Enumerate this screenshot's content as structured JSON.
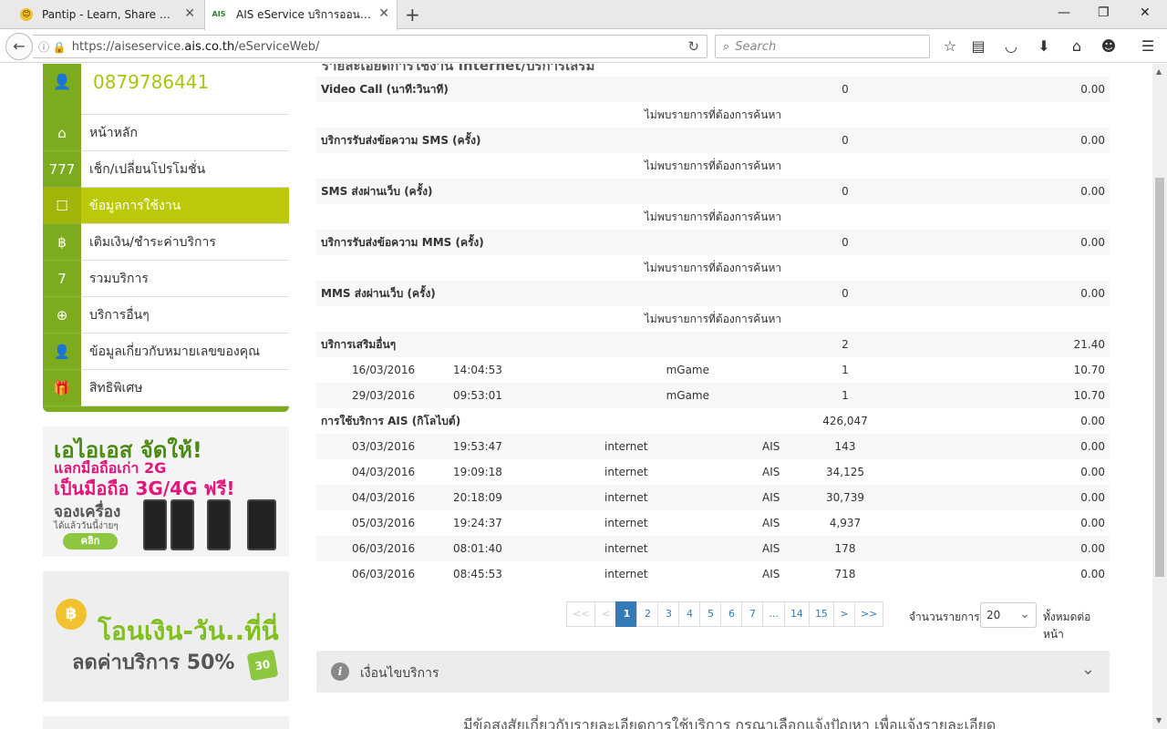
{
  "browser": {
    "tabs": [
      {
        "label": "Pantip - Learn, Share & Fun",
        "favicon": "😊"
      },
      {
        "label": "AIS eService บริการออนไลน์...",
        "favicon": "AIS"
      }
    ],
    "new_tab": "+",
    "url_prefix": "https://aiseservice.",
    "url_domain": "ais.co.th",
    "url_path": "/eServiceWeb/",
    "search_placeholder": "Search",
    "icons": [
      "star-icon",
      "reading-list-icon",
      "pocket-icon",
      "download-icon",
      "home-icon",
      "smiley-icon",
      "hamburger-menu-icon"
    ]
  },
  "sidebar": {
    "phone": "0879786441",
    "items": [
      {
        "label": "หน้าหลัก",
        "icon": "⌂"
      },
      {
        "label": "เช็ก/เปลี่ยนโปรโมชั่น",
        "icon": "777"
      },
      {
        "label": "ข้อมูลการใช้งาน",
        "icon": "☐"
      },
      {
        "label": "เติมเงิน/ชำระค่าบริการ",
        "icon": "฿"
      },
      {
        "label": "รวมบริการ",
        "icon": "7"
      },
      {
        "label": "บริการอื่นๆ",
        "icon": "⊕"
      },
      {
        "label": "ข้อมูลเกี่ยวกับหมายเลขของคุณ",
        "icon": "👤"
      },
      {
        "label": "สิทธิพิเศษ",
        "icon": "🎁"
      }
    ],
    "banner1": {
      "l1": "เอไอเอส จัดให้!",
      "l2": "แลกมือถือเก่า 2G",
      "l3": "เป็นมือถือ 3G/4G ฟรี!",
      "l4": "จองเครื่อง",
      "l5": "ได้แล้ววันนี้ง่ายๆ",
      "cta": "คลิก"
    },
    "banner2": {
      "l1": "โอนเงิน-วัน..ที่นี่",
      "l2": "ลดค่าบริการ 50%",
      "badge": "30"
    }
  },
  "main": {
    "section_title": "รายละเอียดการใช้งาน Internet/บริการเสริม",
    "not_found": "ไม่พบรายการที่ต้องการค้นหา",
    "categories": [
      {
        "name": "Video Call (นาที:วินาที)",
        "count": "0",
        "amount": "0.00"
      },
      {
        "name": "บริการรับส่งข้อความ SMS (ครั้ง)",
        "count": "0",
        "amount": "0.00"
      },
      {
        "name": "SMS ส่งผ่านเว็บ (ครั้ง)",
        "count": "0",
        "amount": "0.00"
      },
      {
        "name": "บริการรับส่งข้อความ MMS (ครั้ง)",
        "count": "0",
        "amount": "0.00"
      },
      {
        "name": "MMS ส่งผ่านเว็บ (ครั้ง)",
        "count": "0",
        "amount": "0.00"
      }
    ],
    "other": {
      "name": "บริการเสริมอื่นๆ",
      "count": "2",
      "amount": "21.40",
      "rows": [
        {
          "date": "16/03/2016",
          "time": "14:04:53",
          "service": "mGame",
          "qty": "1",
          "amount": "10.70"
        },
        {
          "date": "29/03/2016",
          "time": "09:53:01",
          "service": "mGame",
          "qty": "1",
          "amount": "10.70"
        }
      ]
    },
    "ais": {
      "name": "การใช้บริการ AIS (กิโลไบต์)",
      "count": "426,047",
      "amount": "0.00",
      "rows": [
        {
          "date": "03/03/2016",
          "time": "19:53:47",
          "type": "internet",
          "net": "AIS",
          "qty": "143",
          "amount": "0.00"
        },
        {
          "date": "04/03/2016",
          "time": "19:09:18",
          "type": "internet",
          "net": "AIS",
          "qty": "34,125",
          "amount": "0.00"
        },
        {
          "date": "04/03/2016",
          "time": "20:18:09",
          "type": "internet",
          "net": "AIS",
          "qty": "30,739",
          "amount": "0.00"
        },
        {
          "date": "05/03/2016",
          "time": "19:24:37",
          "type": "internet",
          "net": "AIS",
          "qty": "4,937",
          "amount": "0.00"
        },
        {
          "date": "06/03/2016",
          "time": "08:01:40",
          "type": "internet",
          "net": "AIS",
          "qty": "178",
          "amount": "0.00"
        },
        {
          "date": "06/03/2016",
          "time": "08:45:53",
          "type": "internet",
          "net": "AIS",
          "qty": "718",
          "amount": "0.00"
        }
      ]
    },
    "pagination": {
      "pages": [
        "<<",
        "<",
        "1",
        "2",
        "3",
        "4",
        "5",
        "6",
        "7",
        "...",
        "14",
        "15",
        ">",
        ">>"
      ],
      "current": "1",
      "per_page_label": "จำนวนรายการ",
      "per_page_value": "20",
      "per_page_after": "ทั้งหมดต่อหน้า"
    },
    "terms": {
      "label": "เงื่อนไขบริการ"
    },
    "footer_note": "มีข้อสงสัยเกี่ยวกับรายละเอียดการใช้บริการ กรุณาเลือกแจ้งปัญหา เพื่อแจ้งรายละเอียด"
  },
  "colors": {
    "brand_green": "#7dab1f",
    "active_lime": "#bcc90a",
    "phone_text": "#a9c40f",
    "pager_blue": "#337ab7"
  }
}
